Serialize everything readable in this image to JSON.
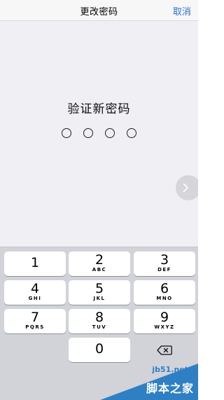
{
  "navbar": {
    "title": "更改密码",
    "cancel_label": "取消"
  },
  "content": {
    "prompt": "验证新密码",
    "passcode_length": 4,
    "entered_digits": 0,
    "next_icon": "chevron-right-icon"
  },
  "keypad": {
    "keys": [
      {
        "number": "1",
        "letters": ""
      },
      {
        "number": "2",
        "letters": "ABC"
      },
      {
        "number": "3",
        "letters": "DEF"
      },
      {
        "number": "4",
        "letters": "GHI"
      },
      {
        "number": "5",
        "letters": "JKL"
      },
      {
        "number": "6",
        "letters": "MNO"
      },
      {
        "number": "7",
        "letters": "PQRS"
      },
      {
        "number": "8",
        "letters": "TUV"
      },
      {
        "number": "9",
        "letters": "WXYZ"
      },
      {
        "number": "0",
        "letters": ""
      }
    ],
    "delete_icon": "backspace-icon"
  },
  "watermark": {
    "url": "jb51.net",
    "text": "脚本之家"
  },
  "colors": {
    "accent": "#2f6fd1",
    "background": "#efeff4",
    "keypad_background": "#d1d3d9",
    "watermark": "#2f7fc4"
  }
}
